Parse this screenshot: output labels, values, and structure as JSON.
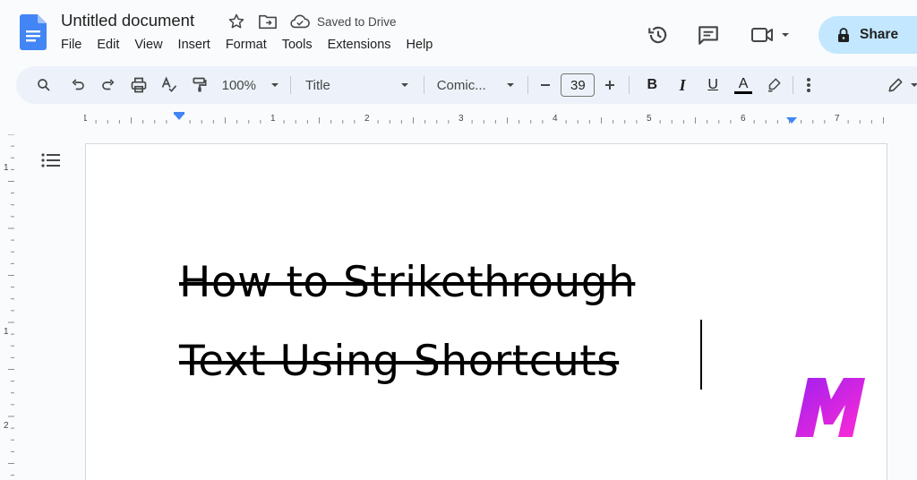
{
  "header": {
    "doc_title": "Untitled document",
    "saved_status": "Saved to Drive",
    "menu": [
      "File",
      "Edit",
      "View",
      "Insert",
      "Format",
      "Tools",
      "Extensions",
      "Help"
    ],
    "share_label": "Share"
  },
  "toolbar": {
    "zoom": "100%",
    "style": "Title",
    "font": "Comic...",
    "font_size": "39",
    "bold": "B",
    "italic": "I",
    "underline": "U",
    "text_color": "A"
  },
  "ruler": {
    "labels": [
      "1",
      "1",
      "2",
      "3",
      "4",
      "5",
      "6",
      "7"
    ],
    "vlabels": [
      "1",
      "1",
      "2"
    ]
  },
  "document": {
    "lines": [
      "How to Strikethrough",
      "Text Using Shortcuts"
    ]
  },
  "colors": {
    "accent": "#c2e7ff",
    "toolbar_bg": "#edf2fa",
    "docs_blue": "#4285f4",
    "brand_gradient_start": "#a020f0",
    "brand_gradient_end": "#ff2ad4"
  },
  "icons": [
    "docs-logo-icon",
    "star-icon",
    "move-folder-icon",
    "cloud-saved-icon",
    "history-icon",
    "comment-icon",
    "meet-icon",
    "lock-icon",
    "search-icon",
    "undo-icon",
    "redo-icon",
    "print-icon",
    "spellcheck-icon",
    "paint-format-icon",
    "minus-icon",
    "plus-icon",
    "highlight-icon",
    "more-icon",
    "edit-mode-icon",
    "outline-icon"
  ]
}
